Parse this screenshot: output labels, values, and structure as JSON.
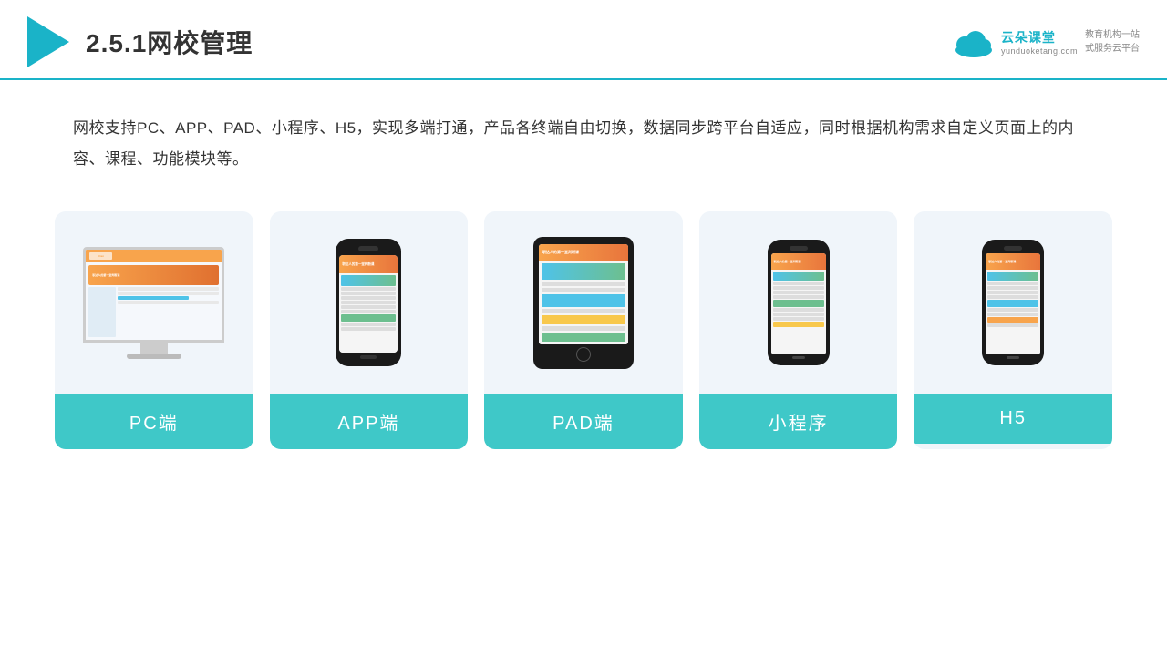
{
  "header": {
    "title": "2.5.1网校管理",
    "logo_main": "云朵课堂",
    "logo_sub": "yunduoketang.com",
    "tagline_line1": "教育机构一站",
    "tagline_line2": "式服务云平台"
  },
  "description": {
    "text": "网校支持PC、APP、PAD、小程序、H5，实现多端打通，产品各终端自由切换，数据同步跨平台自适应，同时根据机构需求自定义页面上的内容、课程、功能模块等。"
  },
  "cards": [
    {
      "id": "pc",
      "label": "PC端"
    },
    {
      "id": "app",
      "label": "APP端"
    },
    {
      "id": "pad",
      "label": "PAD端"
    },
    {
      "id": "miniprogram",
      "label": "小程序"
    },
    {
      "id": "h5",
      "label": "H5"
    }
  ]
}
